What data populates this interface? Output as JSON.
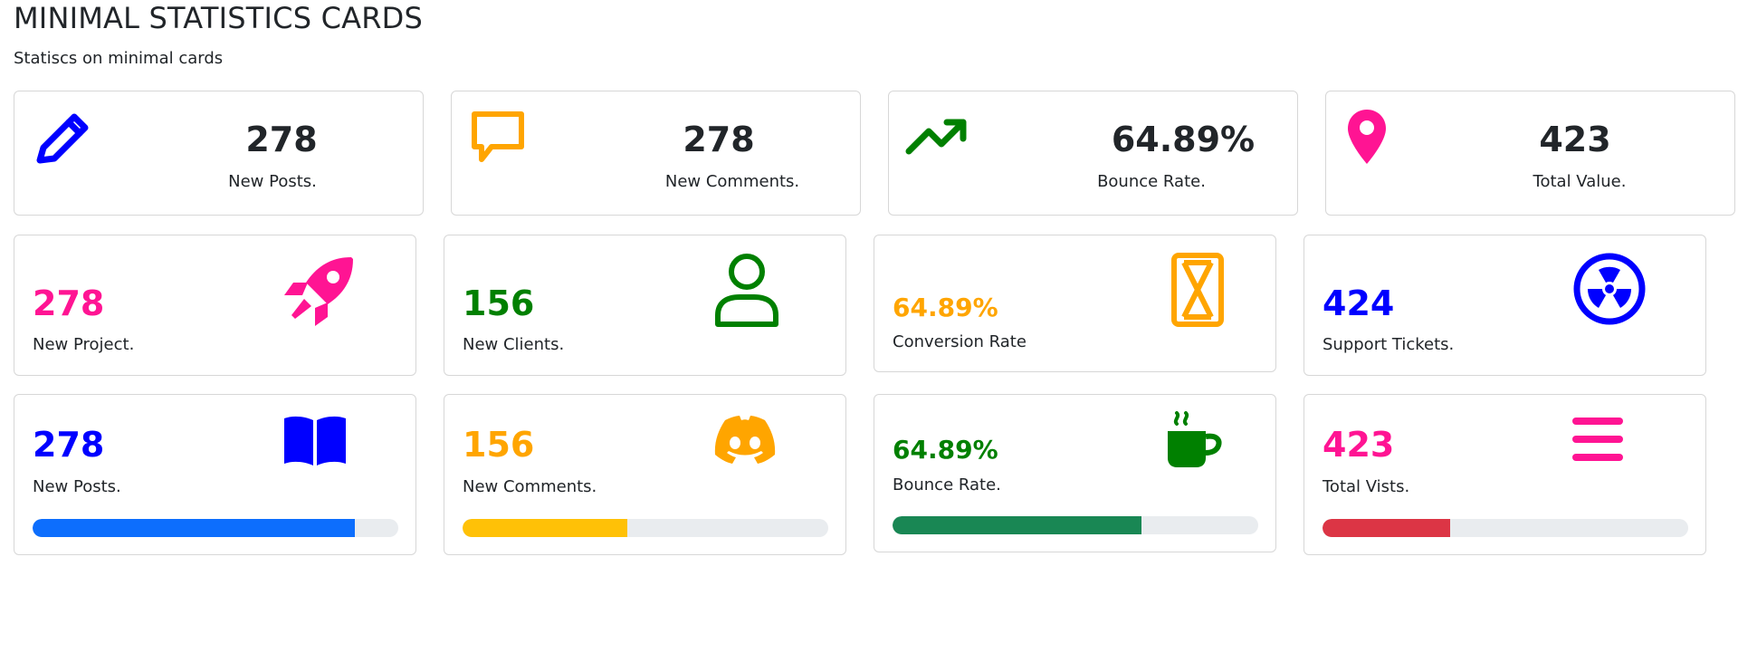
{
  "header": {
    "title": "MINIMAL STATISTICS CARDS",
    "subtitle": "Statiscs on minimal cards"
  },
  "row1": [
    {
      "value": "278",
      "label": "New Posts.",
      "icon": "pencil-icon",
      "color": "#0000ff"
    },
    {
      "value": "278",
      "label": "New Comments.",
      "icon": "chat-bubble-icon",
      "color": "#ffa500"
    },
    {
      "value": "64.89%",
      "label": "Bounce Rate.",
      "icon": "trending-up-icon",
      "color": "#008000"
    },
    {
      "value": "423",
      "label": "Total Value.",
      "icon": "map-pin-icon",
      "color": "#ff1493"
    }
  ],
  "row2": [
    {
      "value": "278",
      "label": "New Project.",
      "icon": "rocket-icon",
      "color": "#ff1493"
    },
    {
      "value": "156",
      "label": "New Clients.",
      "icon": "user-icon",
      "color": "#008000"
    },
    {
      "value": "64.89%",
      "label": "Conversion Rate",
      "icon": "hourglass-icon",
      "color": "#ffa500"
    },
    {
      "value": "424",
      "label": "Support Tickets.",
      "icon": "radiation-icon",
      "color": "#0000ff"
    }
  ],
  "row3": [
    {
      "value": "278",
      "label": "New Posts.",
      "icon": "book-icon",
      "color": "#0000ff",
      "progress": 0.88,
      "bar_color": "#0d6efd"
    },
    {
      "value": "156",
      "label": "New Comments.",
      "icon": "discord-icon",
      "color": "#ffa500",
      "progress": 0.45,
      "bar_color": "#ffc107"
    },
    {
      "value": "64.89%",
      "label": "Bounce Rate.",
      "icon": "coffee-cup-icon",
      "color": "#008000",
      "progress": 0.68,
      "bar_color": "#198754"
    },
    {
      "value": "423",
      "label": "Total Vists.",
      "icon": "menu-icon",
      "color": "#ff1493",
      "progress": 0.35,
      "bar_color": "#dc3545"
    }
  ]
}
